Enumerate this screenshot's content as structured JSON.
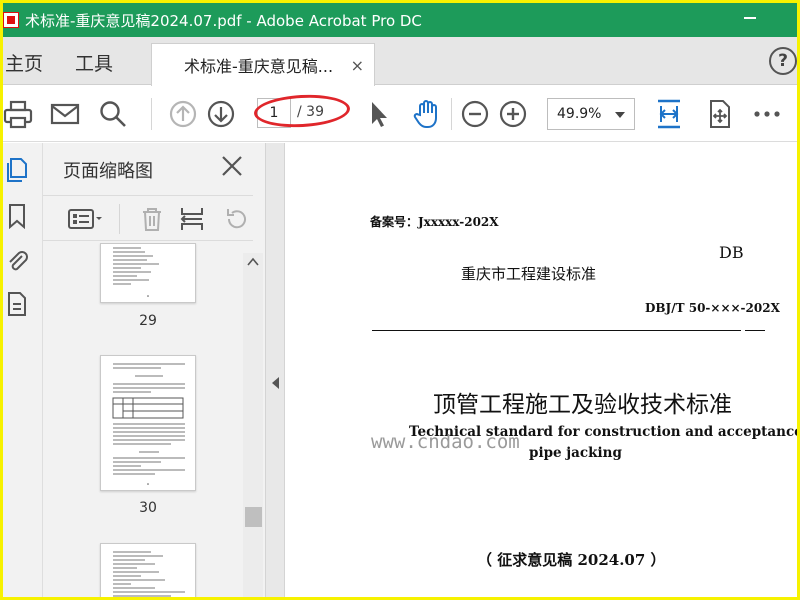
{
  "window": {
    "title": "术标准-重庆意见稿2024.07.pdf - Adobe Acrobat Pro DC"
  },
  "tabs": {
    "home": "主页",
    "tools": "工具",
    "document": "术标准-重庆意见稿...",
    "close": "×",
    "help": "?"
  },
  "toolbar": {
    "page_current": "1",
    "page_total": "/ 39",
    "zoom": "49.9%"
  },
  "thumbnails": {
    "title": "页面缩略图",
    "pages": [
      {
        "number": "29"
      },
      {
        "number": "30"
      }
    ]
  },
  "document": {
    "record_no": "备案号：Jxxxxx-202X",
    "db": "DB",
    "standard_org": "重庆市工程建设标准",
    "std_code": "DBJ/T  50-×××-202X",
    "title_cn": "顶管工程施工及验收技术标准",
    "title_en_line1": "Technical standard for construction and acceptance of",
    "title_en_line2": "pipe jacking",
    "draft": "（ 征求意见稿 2024.07 ）"
  },
  "watermark": "www.cndao.com",
  "colors": {
    "titlebar": "#1d9b5a",
    "border": "#f7f200",
    "accent_blue": "#1e73c8",
    "annotation_red": "#e0262b"
  },
  "icons": [
    "print-icon",
    "email-icon",
    "search-icon",
    "page-up-icon",
    "page-down-icon",
    "select-cursor-icon",
    "hand-tool-icon",
    "zoom-out-icon",
    "zoom-in-icon",
    "fit-page-icon",
    "scroll-mode-icon",
    "more-icon",
    "pages-icon",
    "bookmark-icon",
    "attachment-icon",
    "document-props-icon",
    "thumbnail-options-icon",
    "delete-icon",
    "insert-page-icon",
    "undo-icon"
  ]
}
